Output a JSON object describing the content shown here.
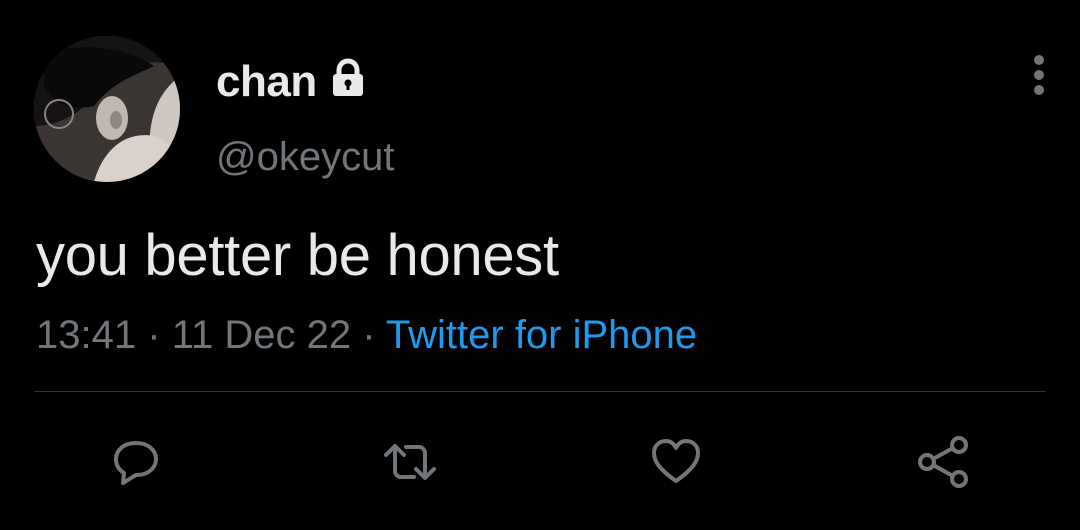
{
  "tweet": {
    "display_name": "chan",
    "handle": "@okeycut",
    "text": "you better be honest",
    "time": "13:41",
    "separator": "·",
    "date": "11 Dec 22",
    "source": "Twitter for iPhone"
  },
  "icons": {
    "lock": "lock-icon",
    "more": "more-vertical-icon",
    "reply": "reply-icon",
    "retweet": "retweet-icon",
    "like": "heart-icon",
    "share": "share-icon"
  },
  "colors": {
    "background": "#000000",
    "primary_text": "#e7e9ea",
    "secondary_text": "#71767b",
    "link": "#1d9bf0",
    "divider": "#2f3336"
  }
}
